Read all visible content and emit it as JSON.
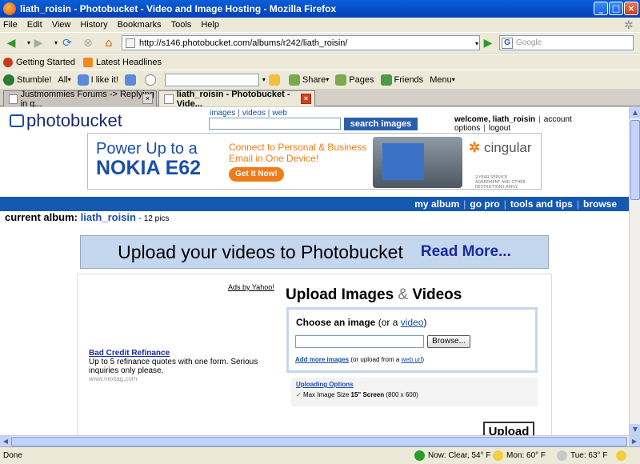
{
  "window": {
    "title": "liath_roisin - Photobucket - Video and Image Hosting - Mozilla Firefox"
  },
  "menu": [
    "File",
    "Edit",
    "View",
    "History",
    "Bookmarks",
    "Tools",
    "Help"
  ],
  "nav": {
    "url": "http://s146.photobucket.com/albums/r242/liath_roisin/",
    "search_placeholder": "Google"
  },
  "bookmarks": [
    {
      "label": "Getting Started",
      "icon": "firefox-icon"
    },
    {
      "label": "Latest Headlines",
      "icon": "rss-icon"
    }
  ],
  "stumble": {
    "stumble": "Stumble!",
    "all": "All",
    "like": "I like it!",
    "share": "Share",
    "pages": "Pages",
    "friends": "Friends",
    "menu": "Menu"
  },
  "tabs": [
    {
      "label": "Justmommies Forums -> Replying in q...",
      "active": false
    },
    {
      "label": "liath_roisin - Photobucket - Vide...",
      "active": true
    }
  ],
  "pb": {
    "logo": "photobucket",
    "search_links": [
      "images",
      "videos",
      "web"
    ],
    "search_button": "search images",
    "welcome": "welcome, liath_roisin",
    "account_options": "account options",
    "logout": "logout",
    "nav": [
      "my album",
      "go pro",
      "tools and tips",
      "browse"
    ],
    "current_album_label": "current album:",
    "album_name": "liath_roisin",
    "album_count": "- 12 pics",
    "upload_banner": "Upload your videos to Photobucket",
    "read_more": "Read More...",
    "ads_by_yahoo": "Ads by Yahoo!",
    "ad_link": {
      "title": "Bad Credit Refinance",
      "desc": "Up to 5 refinance quotes with one form. Serious inquiries only please.",
      "url": "www.nextag.com"
    },
    "upload_title_a": "Upload Images",
    "upload_title_amp": " & ",
    "upload_title_b": "Videos",
    "choose_image": "Choose an image",
    "or_a": " (or a ",
    "video": "video",
    "close_paren": ")",
    "browse": "Browse...",
    "add_more": "Add more images",
    "or_upload": " (or upload from a ",
    "web_url": "web url",
    "close_paren2": ")",
    "uploading_options": "Uploading Options",
    "max_size_label": "Max Image Size",
    "max_size_value": "15\" Screen",
    "max_size_dims": "(800 x 600)",
    "upload_button": "Upload"
  },
  "banner_ad": {
    "line1": "Power Up to a",
    "line2": "NOKIA E62",
    "mid1": "Connect to Personal & Business",
    "mid2": "Email in One Device!",
    "cta": "Get It Now!",
    "brand": "cingular",
    "fine": "2-YEAR SERVICE AGREEMENT AND OTHER RESTRICTIONS APPLY."
  },
  "status": {
    "done": "Done",
    "now": "Now: Clear, 54° F",
    "mon": "Mon: 60° F",
    "tue": "Tue: 63° F"
  },
  "colors": {
    "pb_blue": "#1458b0",
    "link_blue": "#1a4ea8",
    "banner_bg": "#c5d6ef",
    "ad_orange": "#f07b18"
  }
}
